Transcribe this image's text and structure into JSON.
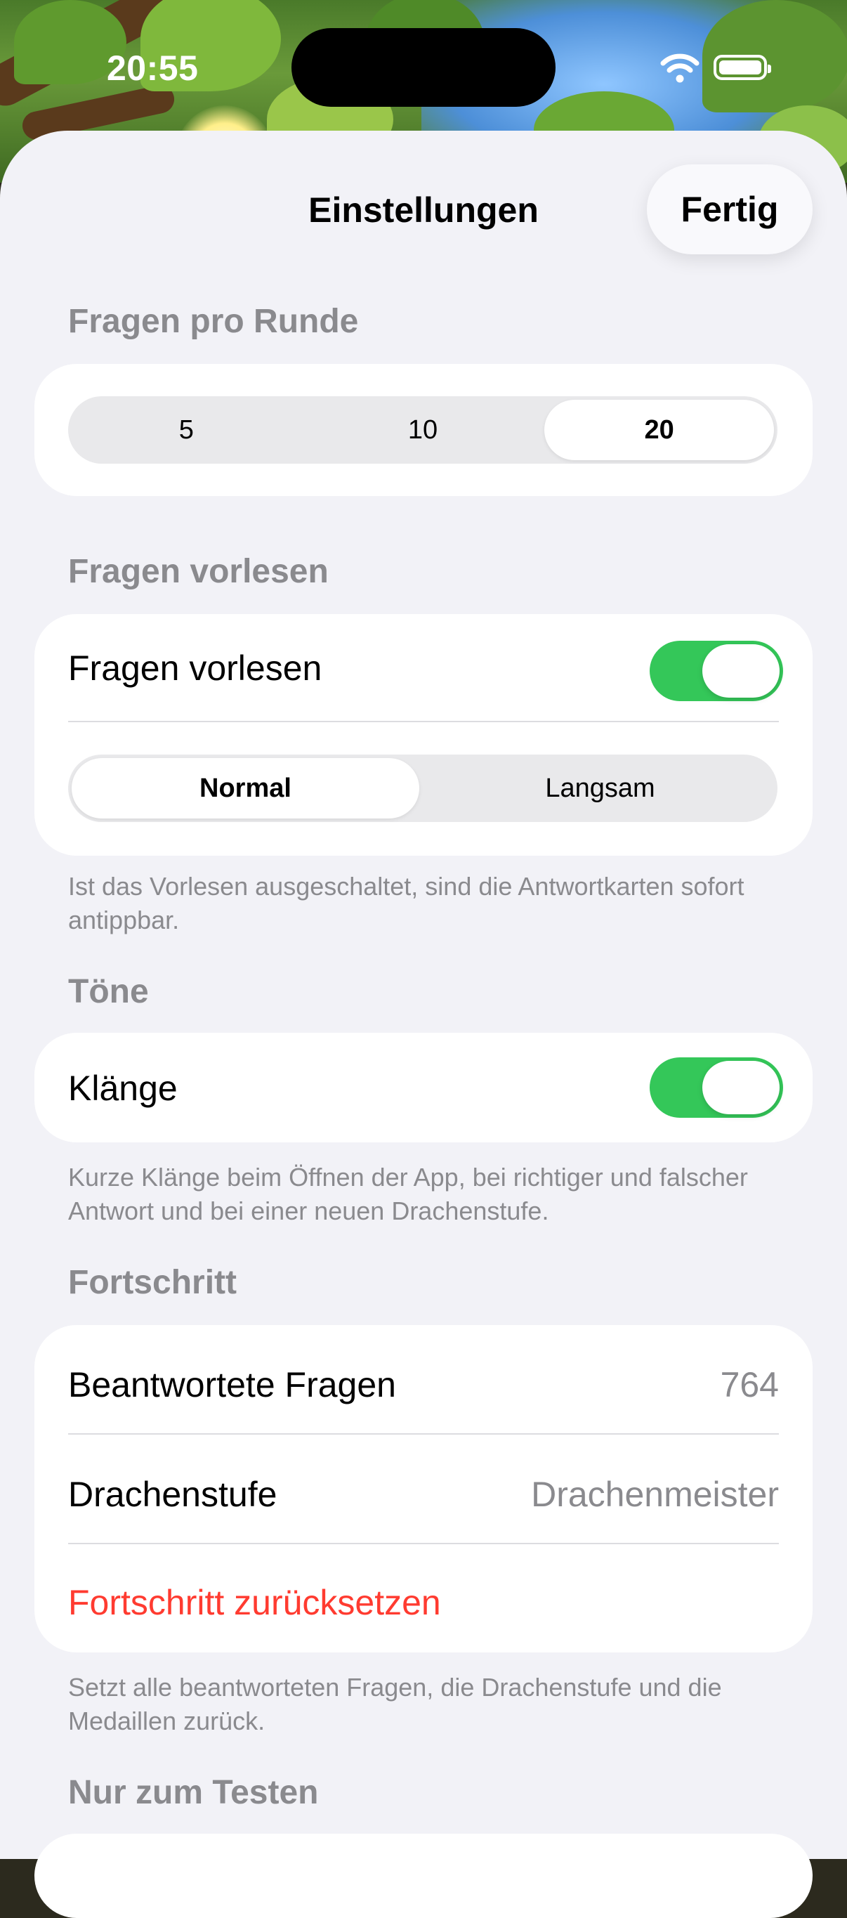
{
  "status_bar": {
    "time": "20:55",
    "wifi_icon": "wifi-icon",
    "battery_icon": "battery-icon"
  },
  "header": {
    "title": "Einstellungen",
    "done_label": "Fertig"
  },
  "questions_per_round": {
    "header": "Fragen pro Runde",
    "options": [
      "5",
      "10",
      "20"
    ],
    "selected": "20"
  },
  "read_aloud": {
    "header": "Fragen vorlesen",
    "toggle_label": "Fragen vorlesen",
    "toggle_on": true,
    "speed_options": [
      "Normal",
      "Langsam"
    ],
    "speed_selected": "Normal",
    "footer": "Ist das Vorlesen ausgeschaltet, sind die Antwortkarten sofort antippbar."
  },
  "sounds": {
    "header": "Töne",
    "toggle_label": "Klänge",
    "toggle_on": true,
    "footer": "Kurze Klänge beim Öffnen der App, bei richtiger und falscher Antwort und bei einer neuen Drachenstufe."
  },
  "progress": {
    "header": "Fortschritt",
    "answered_label": "Beantwortete Fragen",
    "answered_value": "764",
    "level_label": "Drachenstufe",
    "level_value": "Drachenmeister",
    "reset_label": "Fortschritt zurücksetzen",
    "footer": "Setzt alle beantworteten Fragen, die Drachenstufe und die Medaillen zurück."
  },
  "testing": {
    "header": "Nur zum Testen"
  },
  "colors": {
    "accent_green": "#34c759",
    "danger_red": "#ff3b30",
    "secondary_gray": "#8a8a8e",
    "background": "#f2f2f7"
  }
}
